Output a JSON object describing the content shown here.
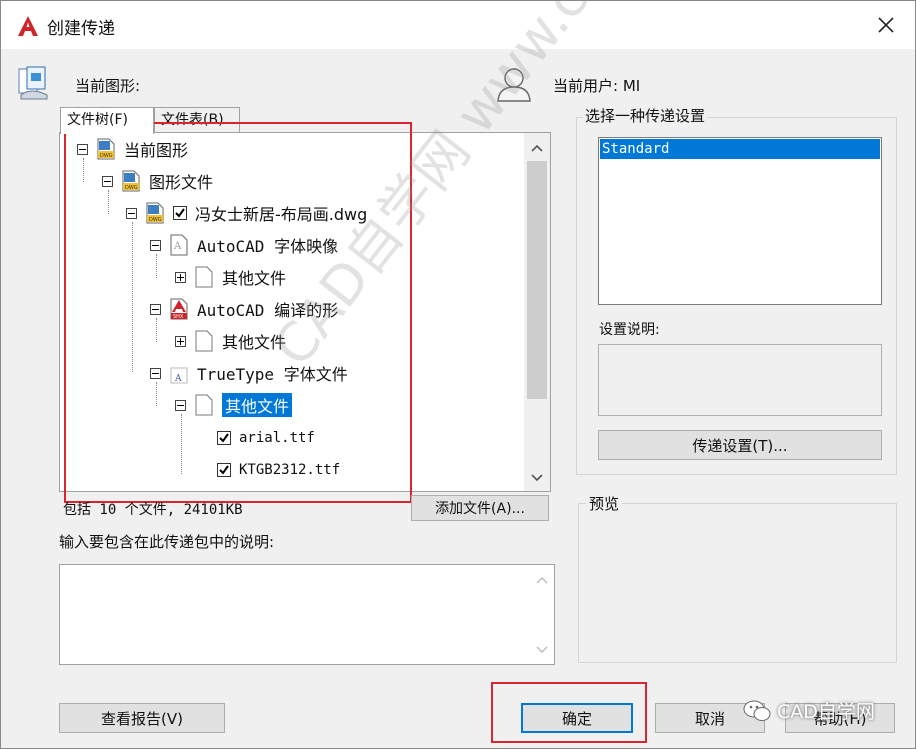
{
  "window": {
    "title": "创建传递",
    "close_glyph": "✕"
  },
  "header": {
    "current_drawing_label": "当前图形:",
    "current_user_label": "当前用户: MI"
  },
  "tabs": [
    {
      "label": "文件树(F)",
      "active": true
    },
    {
      "label": "文件表(B)",
      "active": false
    }
  ],
  "tree": {
    "items": [
      {
        "label": "当前图形",
        "icon": "dwg-file-icon",
        "expander": "minus",
        "checkbox": false
      },
      {
        "label": "图形文件",
        "icon": "dwg-file-icon",
        "expander": "minus",
        "checkbox": false
      },
      {
        "label": "冯女士新居-布局画.dwg",
        "icon": "dwg-file-icon",
        "expander": "minus",
        "checkbox": true,
        "checked": true
      },
      {
        "label": "AutoCAD 字体映像",
        "icon": "font-map-file-icon",
        "expander": "minus",
        "checkbox": false
      },
      {
        "label": "其他文件",
        "icon": "blank-file-icon",
        "expander": "plus",
        "checkbox": false
      },
      {
        "label": "AutoCAD 编译的形",
        "icon": "shx-file-icon",
        "expander": "minus",
        "checkbox": false
      },
      {
        "label": "其他文件",
        "icon": "blank-file-icon",
        "expander": "plus",
        "checkbox": false
      },
      {
        "label": "TrueType 字体文件",
        "icon": "truetype-file-icon",
        "expander": "minus",
        "checkbox": false
      },
      {
        "label": "其他文件",
        "icon": "blank-file-icon",
        "expander": "minus",
        "checkbox": false,
        "selected": true
      },
      {
        "label": "arial.ttf",
        "icon": "",
        "expander": "",
        "checkbox": true,
        "checked": true
      },
      {
        "label": "KTGB2312.ttf",
        "icon": "",
        "expander": "",
        "checkbox": true,
        "checked": true
      }
    ]
  },
  "summary": "包括 10 个文件, 24101KB",
  "add_file_button": "添加文件(A)...",
  "notes_label": "输入要包含在此传递包中的说明:",
  "notes_value": "",
  "transmittal": {
    "group_label": "选择一种传递设置",
    "setups": [
      "Standard"
    ],
    "selected": "Standard",
    "description_label": "设置说明:",
    "description_value": "",
    "setups_button": "传递设置(T)..."
  },
  "preview_label": "预览",
  "buttons": {
    "view_report": "查看报告(V)",
    "ok": "确定",
    "cancel": "取消",
    "help": "帮助(H)"
  },
  "watermark": {
    "diagonal_text": "CAD自学网  www.cadzxw.com",
    "badge_text": "CAD自学网"
  },
  "colors": {
    "selection": "#0078d7",
    "annotation_red": "#d9262e",
    "dialog_bg": "#f0f0f0"
  }
}
